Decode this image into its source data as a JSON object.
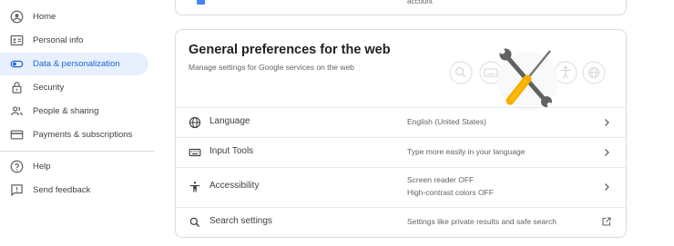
{
  "sidebar": {
    "items": [
      {
        "label": "Home",
        "icon": "account-circle-icon"
      },
      {
        "label": "Personal info",
        "icon": "id-card-icon"
      },
      {
        "label": "Data & personalization",
        "icon": "toggle-icon"
      },
      {
        "label": "Security",
        "icon": "lock-icon"
      },
      {
        "label": "People & sharing",
        "icon": "people-icon"
      },
      {
        "label": "Payments & subscriptions",
        "icon": "credit-card-icon"
      },
      {
        "label": "Help",
        "icon": "help-circle-icon"
      },
      {
        "label": "Send feedback",
        "icon": "feedback-icon"
      }
    ],
    "active": "Data & personalization"
  },
  "top_card": {
    "partial_text": "account"
  },
  "card": {
    "title": "General preferences for the web",
    "subtitle": "Manage settings for Google services on the web",
    "rows": [
      {
        "label": "Language",
        "icon": "globe-icon",
        "value": "English (United States)",
        "action": "chevron-right-icon"
      },
      {
        "label": "Input Tools",
        "icon": "keyboard-icon",
        "value": "Type more easily in your language",
        "action": "chevron-right-icon"
      },
      {
        "label": "Accessibility",
        "icon": "accessibility-icon",
        "value_line1": "Screen reader OFF",
        "value_line2": "High-contrast colors OFF",
        "action": "chevron-right-icon"
      },
      {
        "label": "Search settings",
        "icon": "search-icon",
        "value": "Settings like private results and safe search",
        "action": "open-in-new-icon"
      }
    ]
  },
  "colors": {
    "accent": "#1967d2",
    "active_bg": "#e8f0fe",
    "border": "#dadce0",
    "tool_yellow": "#fbbc04",
    "tool_gray": "#5f6368"
  }
}
